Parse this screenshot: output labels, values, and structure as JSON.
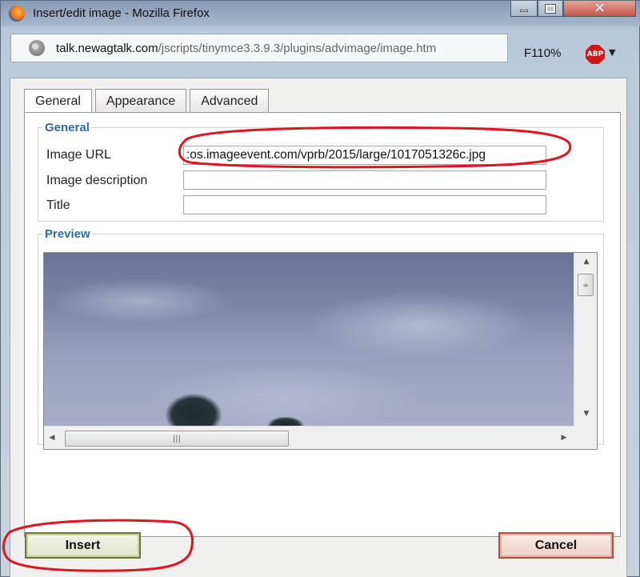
{
  "window": {
    "title": "Insert/edit image - Mozilla Firefox",
    "controls": {
      "minimize": "minimize",
      "maximize": "maximize",
      "close": "✕"
    }
  },
  "addressbar": {
    "url_host": "talk.newagtalk.com",
    "url_path": "/jscripts/tinymce3.3.9.3/plugins/advimage/image.htm",
    "zoom": "F110%",
    "adblock_label": "ABP"
  },
  "tabs": [
    {
      "label": "General",
      "active": true
    },
    {
      "label": "Appearance",
      "active": false
    },
    {
      "label": "Advanced",
      "active": false
    }
  ],
  "general": {
    "legend": "General",
    "fields": {
      "image_url": {
        "label": "Image URL",
        "value": ":os.imageevent.com/vprb/2015/large/1017051326c.jpg"
      },
      "image_description": {
        "label": "Image description",
        "value": ""
      },
      "title": {
        "label": "Title",
        "value": ""
      }
    }
  },
  "preview": {
    "legend": "Preview"
  },
  "buttons": {
    "insert": "Insert",
    "cancel": "Cancel"
  },
  "colors": {
    "legend_blue": "#2b6cb0",
    "annotation_red": "#e0141e",
    "insert_border": "#6b7a3c",
    "cancel_border": "#b0503c"
  },
  "icons": {
    "app": "firefox-icon",
    "site": "globe-icon",
    "adblock": "adblock-plus-icon"
  }
}
